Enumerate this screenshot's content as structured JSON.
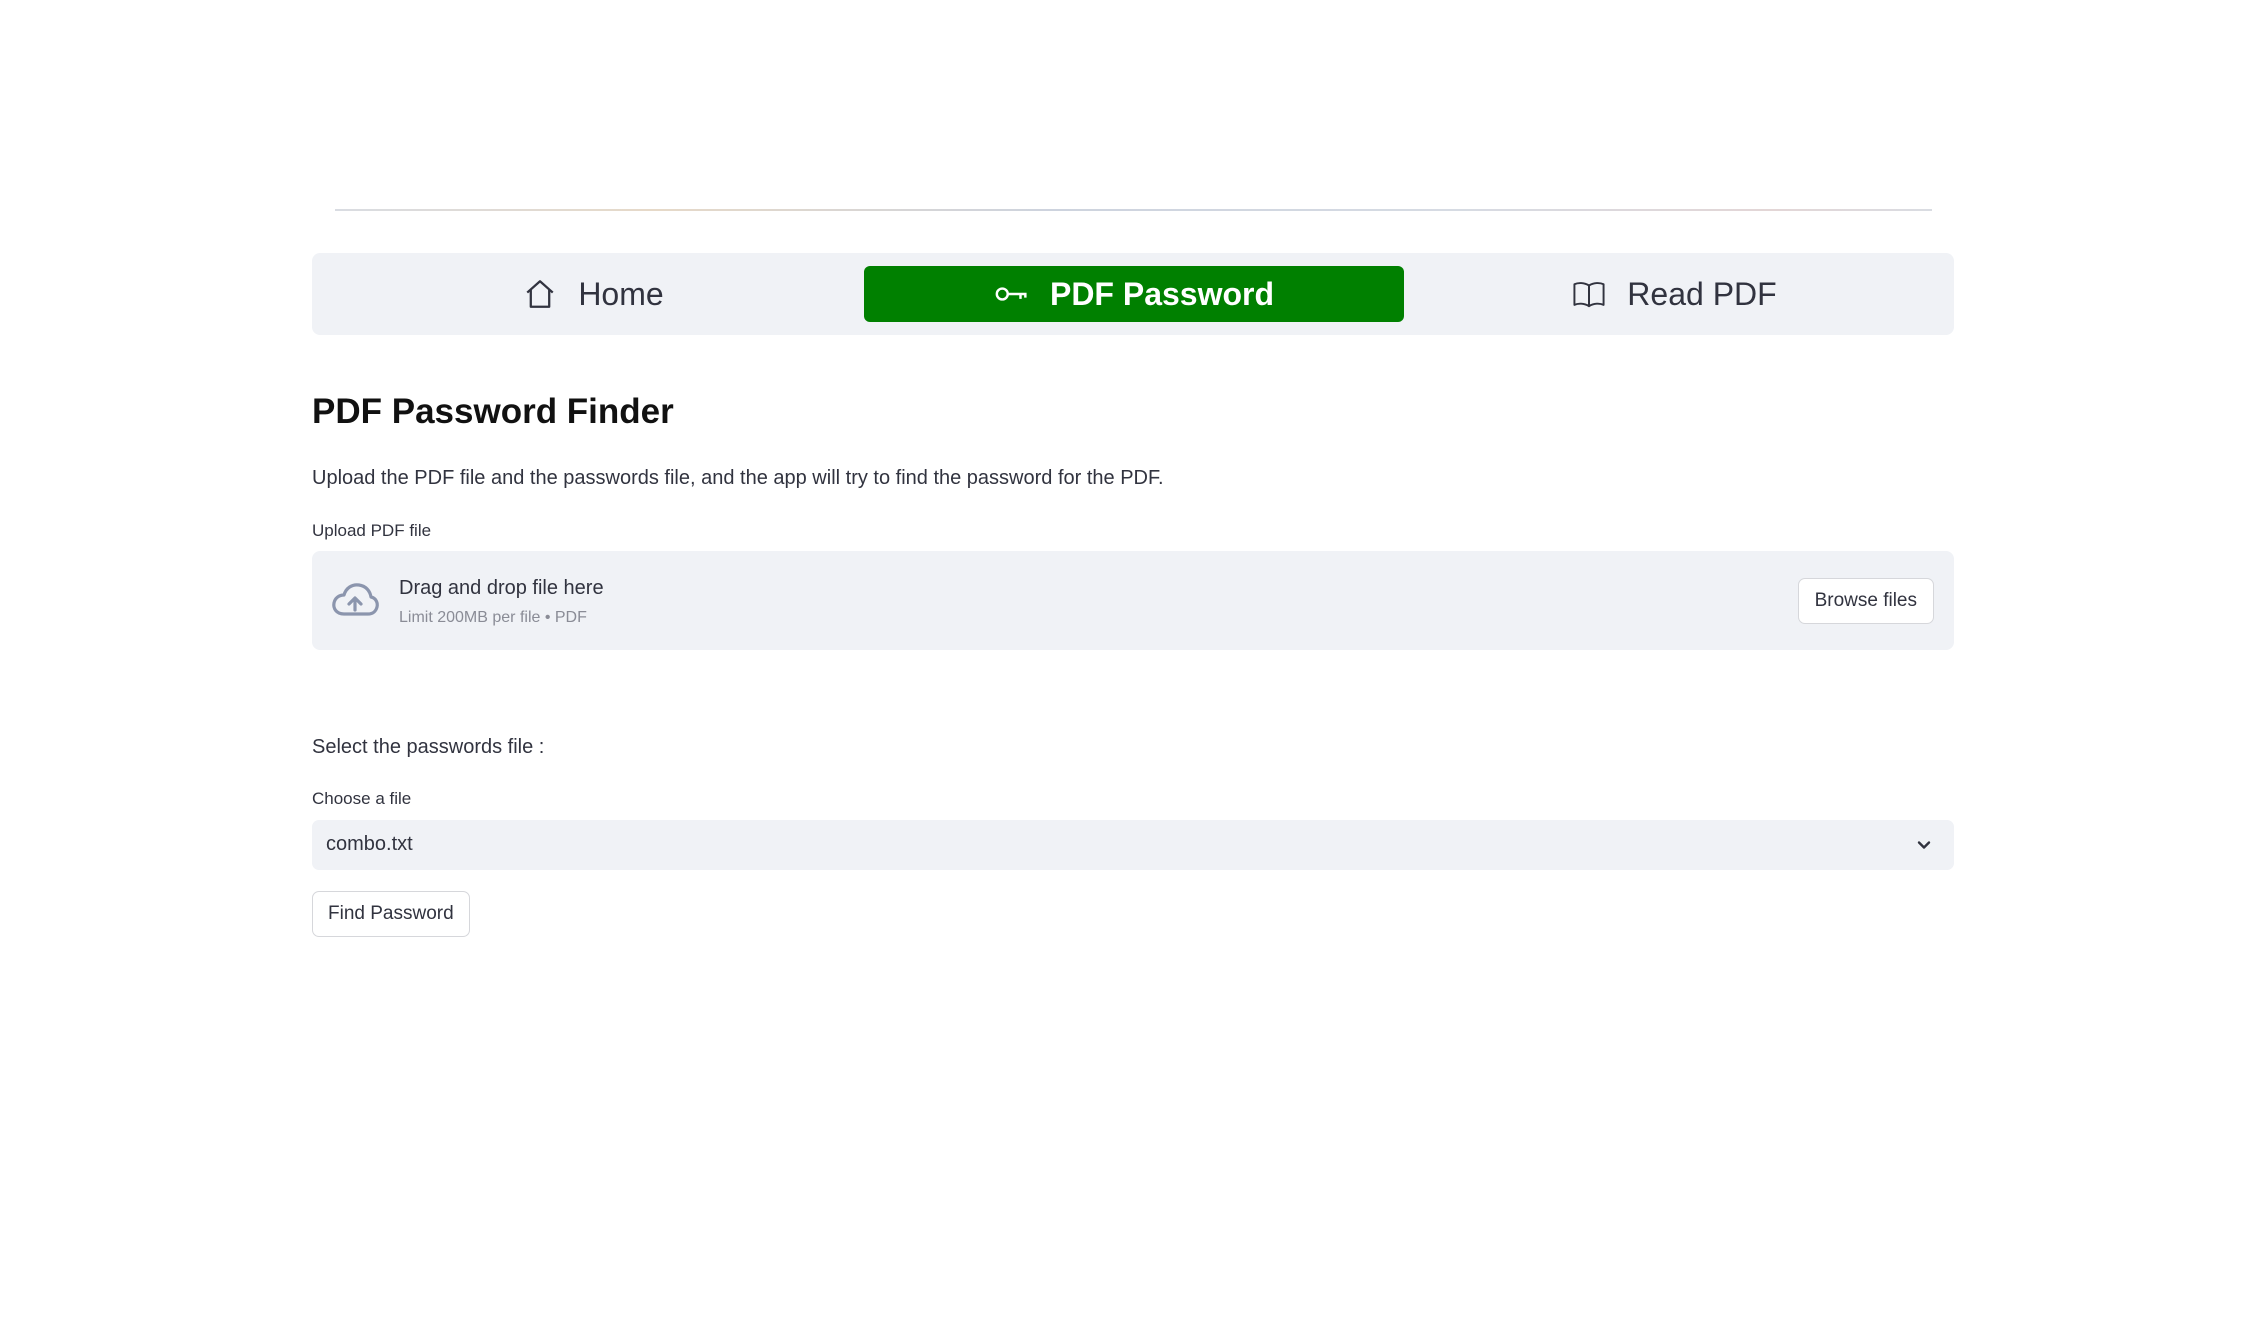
{
  "nav": {
    "items": [
      {
        "label": "Home",
        "icon": "house-icon",
        "active": false
      },
      {
        "label": "PDF Password",
        "icon": "key-icon",
        "active": true
      },
      {
        "label": "Read PDF",
        "icon": "book-icon",
        "active": false
      }
    ],
    "active_color": "#008000"
  },
  "main": {
    "title": "PDF Password Finder",
    "description": "Upload the PDF file and the passwords file, and the app will try to find the password for the PDF."
  },
  "uploader": {
    "label": "Upload PDF file",
    "drag_text": "Drag and drop file here",
    "limit_text": "Limit 200MB per file • PDF",
    "browse_label": "Browse files",
    "icon": "cloud-upload-icon"
  },
  "passwords": {
    "section_label": "Select the passwords file :",
    "select_label": "Choose a file",
    "selected_value": "combo.txt"
  },
  "actions": {
    "find_label": "Find Password"
  }
}
